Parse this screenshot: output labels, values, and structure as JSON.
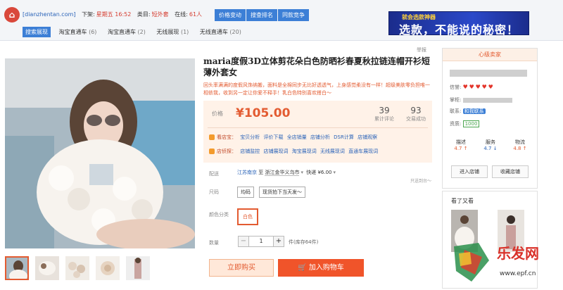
{
  "topbar": {
    "site": "[dianzhentan.com]",
    "download_label": "下架:",
    "download_value": "星期五 16:52",
    "category_label": "类目:",
    "category_value": "短外套",
    "online_label": "在线:",
    "online_value": "61人",
    "buttons": [
      "价格变动",
      "搜查排名",
      "同款竞争"
    ],
    "tabs": [
      {
        "label": "搜索展现",
        "count": ""
      },
      {
        "label": "淘宝直通车",
        "count": "(6)"
      },
      {
        "label": "淘宝直通车",
        "count": "(2)"
      },
      {
        "label": "无线展现",
        "count": "(1)"
      },
      {
        "label": "无线直通车",
        "count": "(20)"
      }
    ],
    "banner_top": "就会选款神器",
    "banner_main": "选款，不能说的秘密！"
  },
  "product": {
    "corner_tag": "举报",
    "title": "maria度假3D立体剪花朵白色防晒衫春夏秋拉链连帽开衫短薄外套女",
    "subtitle": "回头率满满的度假风饰纳搬，面料是全棉同步无比好透透气，上身感觉柔没有一样！超级美肤零负担唯一相依我，收到另一定让你爱不释手！乳白色特别喜欢搭白～",
    "price_label": "价格",
    "price": "¥105.00",
    "reviews_count": "39",
    "reviews_label": "累计评论",
    "sales_count": "93",
    "sales_label": "交易成功",
    "service1_label": "看店宝：",
    "service1_links": [
      "宝贝分析",
      "评价下载",
      "全店销量",
      "店铺分析",
      "DSR计算",
      "店铺观察"
    ],
    "service2_label": "店侦探：",
    "service2_links": [
      "店铺监控",
      "店铺展现词",
      "淘宝展现词",
      "无线展现词",
      "直通车展现词"
    ]
  },
  "purchase": {
    "delivery_label": "配送",
    "origin": "江苏南京",
    "to": "至",
    "dest": "浙江金华义乌市",
    "shipping": "快递 ¥6.00",
    "note": "只送到台～",
    "size_label": "尺码",
    "size_options": [
      "均码",
      "现货拍下当天发～"
    ],
    "color_label": "颜色分类",
    "color_value": "白色",
    "qty_label": "数量",
    "qty_value": "1",
    "minus": "−",
    "plus": "+",
    "stock": "件(库存64件)",
    "buy_label": "立即购买",
    "cart_label": "加入购物车"
  },
  "seller": {
    "header": "心级卖家",
    "credit_label": "信誉:",
    "shopkeeper_label": "掌柜:",
    "contact_label": "联系:",
    "contact_badge": "和我联系",
    "qualification_label": "资质:",
    "qualification_badge": "1000",
    "scores": [
      {
        "label": "描述",
        "value": "4.7",
        "trend": "↑",
        "color": "red"
      },
      {
        "label": "服务",
        "value": "4.7",
        "trend": "↓",
        "color": "blue"
      },
      {
        "label": "物流",
        "value": "4.8",
        "trend": "↑",
        "color": "red"
      }
    ],
    "enter_shop": "进入店铺",
    "fav_shop": "收藏店铺"
  },
  "also": {
    "title": "看了又看"
  },
  "watermark": {
    "text": "乐发网",
    "url": "www.epf.cn"
  },
  "colors": {
    "accent": "#e35b31",
    "blue": "#3c7fd6",
    "cart": "#f0542a"
  }
}
